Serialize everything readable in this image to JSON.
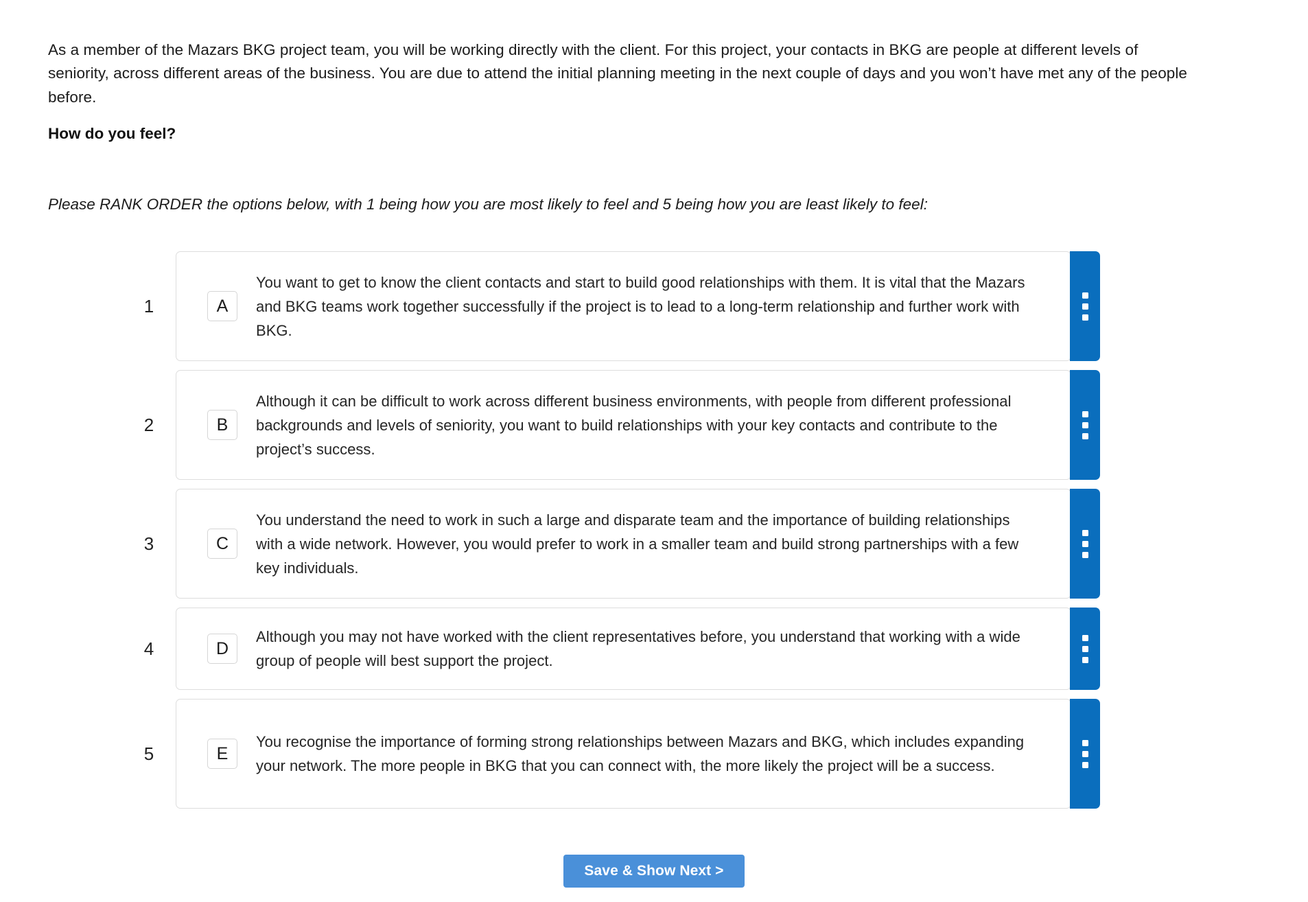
{
  "intro": {
    "paragraph": "As a member of the Mazars BKG project team, you will be working directly with the client. For this project, your contacts in BKG are people at different levels of seniority, across different areas of the business. You are due to attend the initial planning meeting in the next couple of days and you won’t have met any of the people before."
  },
  "heading": "How do you feel?",
  "instruction": "Please RANK ORDER the options below, with 1 being how you are most likely to feel and 5 being how you are least likely to feel:",
  "options": [
    {
      "rank": "1",
      "letter": "A",
      "text": "You want to get to know the client contacts and start to build good relationships with them. It is vital that the Mazars and BKG teams work together successfully if the project is to lead to a long-term relationship and further work with BKG.",
      "lines": 3
    },
    {
      "rank": "2",
      "letter": "B",
      "text": "Although it can be difficult to work across different business environments, with people from different professional backgrounds and levels of seniority, you want to build relationships with your key contacts and contribute to the project’s success.",
      "lines": 3
    },
    {
      "rank": "3",
      "letter": "C",
      "text": "You understand the need to work in such a large and disparate team and the importance of building relationships with a wide network. However, you would prefer to work in a smaller team and build strong partnerships with a few key individuals.",
      "lines": 3
    },
    {
      "rank": "4",
      "letter": "D",
      "text": "Although you may not have worked with the client representatives before, you understand that working with a wide group of people will best support the project.",
      "lines": 2
    },
    {
      "rank": "5",
      "letter": "E",
      "text": "You recognise the importance of forming strong relationships between Mazars and BKG, which includes expanding your network. The more people in BKG that you can connect with, the more likely the project will be a success.",
      "lines": 3
    }
  ],
  "drag_handle": {
    "icon": "drag-dots-icon",
    "dots": 3
  },
  "footer": {
    "save_label": "Save & Show Next >"
  },
  "colors": {
    "drag_handle_blue": "#0a6ebd",
    "save_button_blue": "#4a90d9",
    "card_border": "#dddddd",
    "letter_box_border": "#d5d5d5",
    "text": "#262626",
    "background": "#ffffff"
  }
}
